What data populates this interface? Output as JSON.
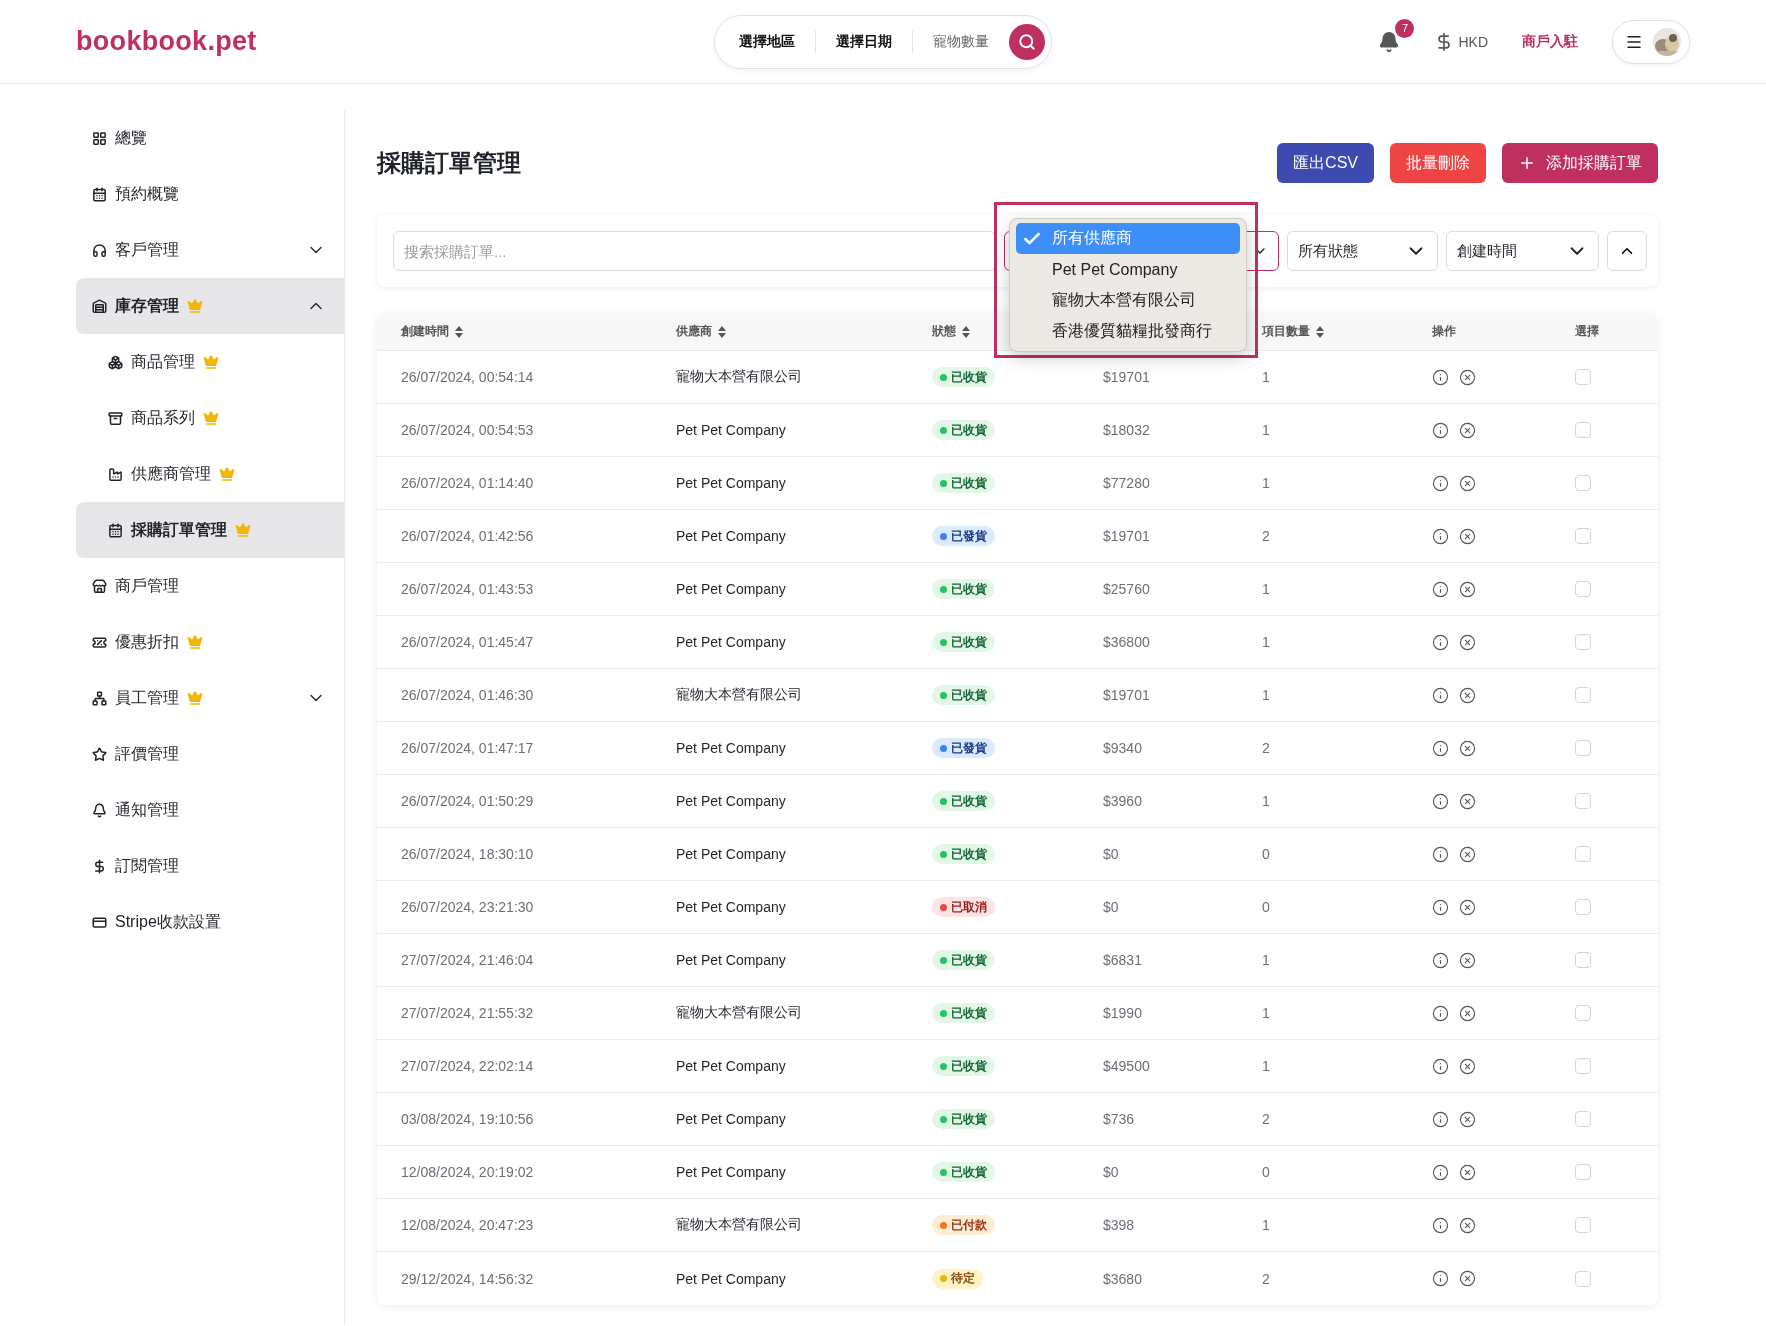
{
  "header": {
    "logo": "bookbook.pet",
    "search_segments": [
      {
        "label": "選擇地區",
        "kind": "value"
      },
      {
        "label": "選擇日期",
        "kind": "value"
      },
      {
        "label": "寵物數量",
        "kind": "hint"
      }
    ],
    "notification_count": "7",
    "currency": "HKD",
    "merchant_link": "商戶入駐"
  },
  "sidebar": {
    "items": [
      {
        "label": "總覽",
        "selected": false,
        "premium": false
      },
      {
        "label": "預約概覽",
        "selected": false,
        "premium": false
      },
      {
        "label": "客戶管理",
        "selected": false,
        "premium": false,
        "expanded": false
      },
      {
        "label": "庫存管理",
        "selected": true,
        "premium": true,
        "expanded": true,
        "children": [
          {
            "label": "商品管理",
            "selected": false,
            "premium": true
          },
          {
            "label": "商品系列",
            "selected": false,
            "premium": true
          },
          {
            "label": "供應商管理",
            "selected": false,
            "premium": true
          },
          {
            "label": "採購訂單管理",
            "selected": true,
            "premium": true
          }
        ]
      },
      {
        "label": "商戶管理",
        "selected": false,
        "premium": false
      },
      {
        "label": "優惠折扣",
        "selected": false,
        "premium": true
      },
      {
        "label": "員工管理",
        "selected": false,
        "premium": true,
        "expanded": false
      },
      {
        "label": "評價管理",
        "selected": false,
        "premium": false
      },
      {
        "label": "通知管理",
        "selected": false,
        "premium": false
      },
      {
        "label": "訂閱管理",
        "selected": false,
        "premium": false
      },
      {
        "label": "Stripe收款設置",
        "selected": false,
        "premium": false
      }
    ]
  },
  "page": {
    "title": "採購訂單管理",
    "buttons": [
      {
        "label": "匯出CSV",
        "kind": "export"
      },
      {
        "label": "批量刪除",
        "kind": "delete"
      },
      {
        "label": "添加採購訂單",
        "kind": "add"
      }
    ]
  },
  "filters": {
    "search": {
      "placeholder": "搜索採購訂單..."
    },
    "supplier_menu": {
      "expanded": true,
      "options": [
        {
          "label": "所有供應商",
          "selected": true
        },
        {
          "label": "Pet Pet Company",
          "selected": false
        },
        {
          "label": "寵物大本營有限公司",
          "selected": false
        },
        {
          "label": "香港優質貓糧批發商行",
          "selected": false
        }
      ]
    },
    "status_select": "所有狀態",
    "sort_select": "創建時間"
  },
  "table": {
    "columns": [
      {
        "label": "創建時間",
        "sortable": true
      },
      {
        "label": "供應商",
        "sortable": true
      },
      {
        "label": "狀態",
        "sortable": true
      },
      {
        "label": "項目數量",
        "sortable": true
      },
      {
        "label": "操作",
        "sortable": false
      },
      {
        "label": "選擇",
        "sortable": false
      }
    ],
    "rows": [
      {
        "created": "26/07/2024, 00:54:14",
        "supplier": "寵物大本營有限公司",
        "status": {
          "label": "已收貨",
          "kind": "received"
        },
        "amount": "$19701",
        "items": "1",
        "checked": false
      },
      {
        "created": "26/07/2024, 00:54:53",
        "supplier": "Pet Pet Company",
        "status": {
          "label": "已收貨",
          "kind": "received"
        },
        "amount": "$18032",
        "items": "1",
        "checked": false
      },
      {
        "created": "26/07/2024, 01:14:40",
        "supplier": "Pet Pet Company",
        "status": {
          "label": "已收貨",
          "kind": "received"
        },
        "amount": "$77280",
        "items": "1",
        "checked": false
      },
      {
        "created": "26/07/2024, 01:42:56",
        "supplier": "Pet Pet Company",
        "status": {
          "label": "已發貨",
          "kind": "shipped"
        },
        "amount": "$19701",
        "items": "2",
        "checked": false
      },
      {
        "created": "26/07/2024, 01:43:53",
        "supplier": "Pet Pet Company",
        "status": {
          "label": "已收貨",
          "kind": "received"
        },
        "amount": "$25760",
        "items": "1",
        "checked": false
      },
      {
        "created": "26/07/2024, 01:45:47",
        "supplier": "Pet Pet Company",
        "status": {
          "label": "已收貨",
          "kind": "received"
        },
        "amount": "$36800",
        "items": "1",
        "checked": false
      },
      {
        "created": "26/07/2024, 01:46:30",
        "supplier": "寵物大本營有限公司",
        "status": {
          "label": "已收貨",
          "kind": "received"
        },
        "amount": "$19701",
        "items": "1",
        "checked": false
      },
      {
        "created": "26/07/2024, 01:47:17",
        "supplier": "Pet Pet Company",
        "status": {
          "label": "已發貨",
          "kind": "shipped"
        },
        "amount": "$9340",
        "items": "2",
        "checked": false
      },
      {
        "created": "26/07/2024, 01:50:29",
        "supplier": "Pet Pet Company",
        "status": {
          "label": "已收貨",
          "kind": "received"
        },
        "amount": "$3960",
        "items": "1",
        "checked": false
      },
      {
        "created": "26/07/2024, 18:30:10",
        "supplier": "Pet Pet Company",
        "status": {
          "label": "已收貨",
          "kind": "received"
        },
        "amount": "$0",
        "items": "0",
        "checked": false
      },
      {
        "created": "26/07/2024, 23:21:30",
        "supplier": "Pet Pet Company",
        "status": {
          "label": "已取消",
          "kind": "cancelled"
        },
        "amount": "$0",
        "items": "0",
        "checked": false
      },
      {
        "created": "27/07/2024, 21:46:04",
        "supplier": "Pet Pet Company",
        "status": {
          "label": "已收貨",
          "kind": "received"
        },
        "amount": "$6831",
        "items": "1",
        "checked": false
      },
      {
        "created": "27/07/2024, 21:55:32",
        "supplier": "寵物大本營有限公司",
        "status": {
          "label": "已收貨",
          "kind": "received"
        },
        "amount": "$1990",
        "items": "1",
        "checked": false
      },
      {
        "created": "27/07/2024, 22:02:14",
        "supplier": "Pet Pet Company",
        "status": {
          "label": "已收貨",
          "kind": "received"
        },
        "amount": "$49500",
        "items": "1",
        "checked": false
      },
      {
        "created": "03/08/2024, 19:10:56",
        "supplier": "Pet Pet Company",
        "status": {
          "label": "已收貨",
          "kind": "received"
        },
        "amount": "$736",
        "items": "2",
        "checked": false
      },
      {
        "created": "12/08/2024, 20:19:02",
        "supplier": "Pet Pet Company",
        "status": {
          "label": "已收貨",
          "kind": "received"
        },
        "amount": "$0",
        "items": "0",
        "checked": false
      },
      {
        "created": "12/08/2024, 20:47:23",
        "supplier": "寵物大本營有限公司",
        "status": {
          "label": "已付款",
          "kind": "paid"
        },
        "amount": "$398",
        "items": "1",
        "checked": false
      },
      {
        "created": "29/12/2024, 14:56:32",
        "supplier": "Pet Pet Company",
        "status": {
          "label": "待定",
          "kind": "pending"
        },
        "amount": "$3680",
        "items": "2",
        "checked": false
      }
    ]
  }
}
